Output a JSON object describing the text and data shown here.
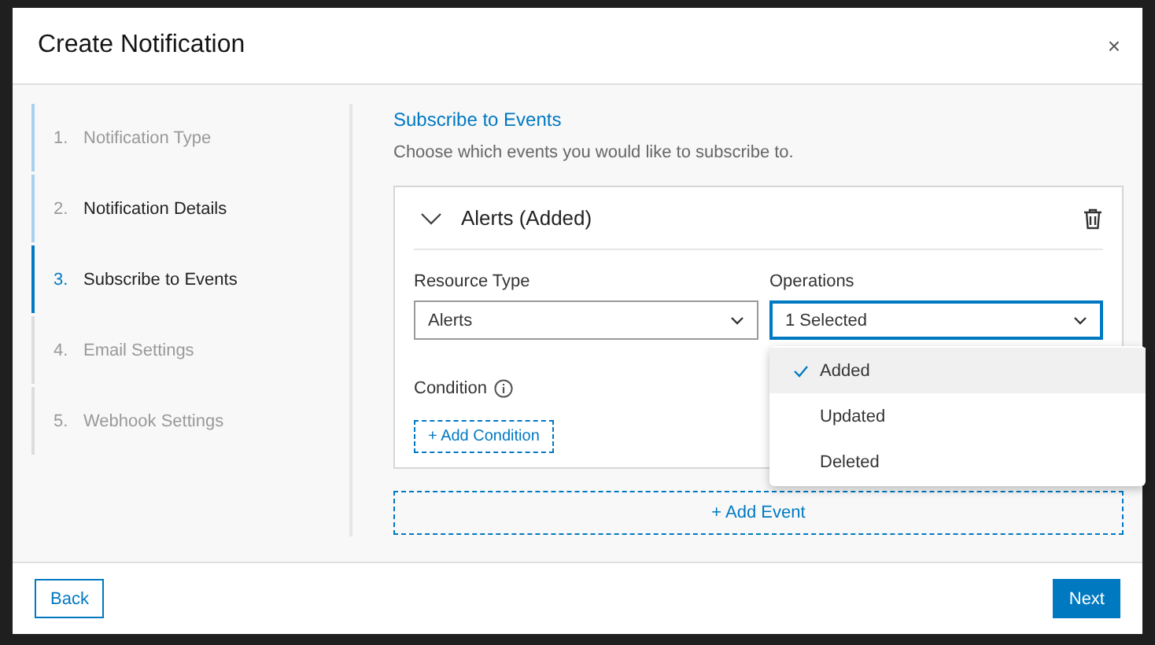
{
  "dialog": {
    "title": "Create Notification",
    "close": "×"
  },
  "steps": [
    {
      "number": "1.",
      "label": "Notification Type",
      "completed": true,
      "selected": false,
      "emphasized": false
    },
    {
      "number": "2.",
      "label": "Notification Details",
      "completed": true,
      "selected": false,
      "emphasized": true
    },
    {
      "number": "3.",
      "label": "Subscribe to Events",
      "completed": false,
      "selected": true,
      "emphasized": true
    },
    {
      "number": "4.",
      "label": "Email Settings",
      "completed": false,
      "selected": false,
      "emphasized": false
    },
    {
      "number": "5.",
      "label": "Webhook Settings",
      "completed": false,
      "selected": false,
      "emphasized": false
    }
  ],
  "section": {
    "title": "Subscribe to Events",
    "description": "Choose which events you would like to subscribe to."
  },
  "event": {
    "title": "Alerts (Added)",
    "expanded": true,
    "resource_type": {
      "label": "Resource Type",
      "value": "Alerts"
    },
    "operations": {
      "label": "Operations",
      "value": "1 Selected",
      "open": true,
      "options": [
        {
          "label": "Added",
          "checked": true
        },
        {
          "label": "Updated",
          "checked": false
        },
        {
          "label": "Deleted",
          "checked": false
        }
      ]
    },
    "condition": {
      "label": "Condition",
      "add_label": "+ Add Condition"
    }
  },
  "add_event": "+ Add Event",
  "footer": {
    "back": "Back",
    "next": "Next"
  }
}
